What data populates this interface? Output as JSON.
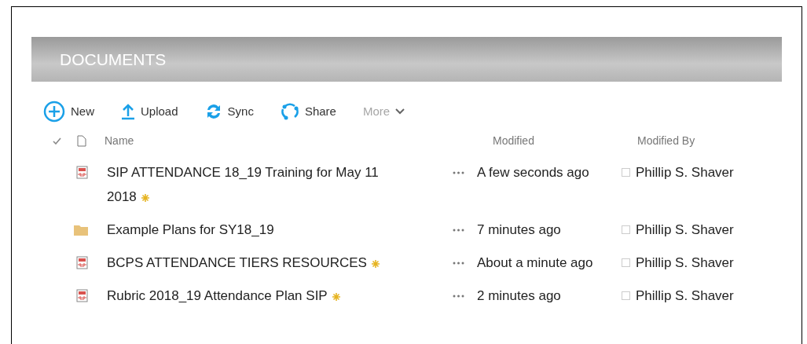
{
  "header": {
    "title": "DOCUMENTS"
  },
  "toolbar": [
    {
      "kind": "new",
      "label": "New",
      "disabled": false
    },
    {
      "kind": "upload",
      "label": "Upload",
      "disabled": false
    },
    {
      "kind": "sync",
      "label": "Sync",
      "disabled": false
    },
    {
      "kind": "share",
      "label": "Share",
      "disabled": false
    },
    {
      "kind": "more",
      "label": "More",
      "disabled": true
    }
  ],
  "table": {
    "columns": [
      "Name",
      "Modified",
      "Modified By"
    ],
    "rows": [
      {
        "kind": "pdf",
        "name": "SIP ATTENDANCE 18_19 Training for May 11 2018",
        "new": true,
        "modified": "A few seconds ago",
        "modified_by": "Phillip S. Shaver"
      },
      {
        "kind": "folder",
        "name": "Example Plans for SY18_19",
        "new": false,
        "modified": "7 minutes ago",
        "modified_by": "Phillip S. Shaver"
      },
      {
        "kind": "pdf",
        "name": "BCPS ATTENDANCE TIERS RESOURCES",
        "new": true,
        "modified": "About a minute ago",
        "modified_by": "Phillip S. Shaver"
      },
      {
        "kind": "pdf",
        "name": "Rubric 2018_19 Attendance Plan SIP",
        "new": true,
        "modified": "2 minutes ago",
        "modified_by": "Phillip S. Shaver"
      }
    ]
  }
}
